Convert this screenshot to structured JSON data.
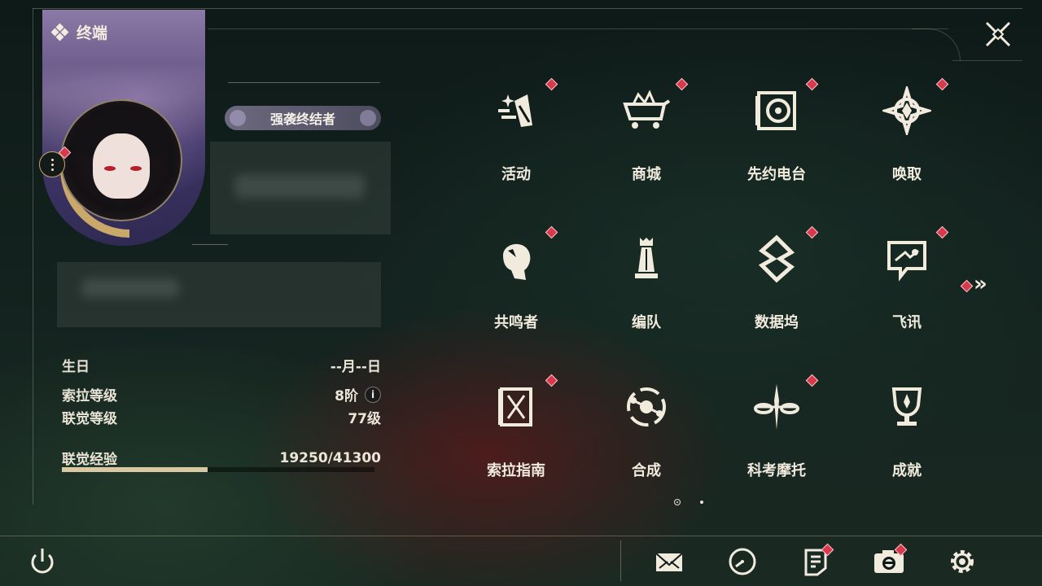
{
  "terminal": {
    "title": "终端"
  },
  "profile": {
    "title_badge": "强袭终结者"
  },
  "stats": {
    "birthday_label": "生日",
    "birthday_value": "--月--日",
    "sola_level_label": "索拉等级",
    "sola_level_value": "8阶",
    "union_level_label": "联觉等级",
    "union_level_value": "77级",
    "union_exp_label": "联觉经验",
    "union_exp_value": "19250/41300",
    "union_exp_progress": 0.466
  },
  "menu": {
    "items": [
      {
        "label": "活动",
        "icon": "activity-icon",
        "badge": true
      },
      {
        "label": "商城",
        "icon": "shop-crown-cart-icon",
        "badge": true
      },
      {
        "label": "先约电台",
        "icon": "radio-icon",
        "badge": true
      },
      {
        "label": "唤取",
        "icon": "convene-compass-icon",
        "badge": true
      },
      {
        "label": "共鸣者",
        "icon": "resonator-head-icon",
        "badge": true
      },
      {
        "label": "编队",
        "icon": "team-chess-icon",
        "badge": false
      },
      {
        "label": "数据坞",
        "icon": "data-bank-icon",
        "badge": true
      },
      {
        "label": "飞讯",
        "icon": "chat-message-icon",
        "badge": true
      },
      {
        "label": "索拉指南",
        "icon": "guidebook-icon",
        "badge": true
      },
      {
        "label": "合成",
        "icon": "synthesis-icon",
        "badge": false
      },
      {
        "label": "科考摩托",
        "icon": "motorbike-icon",
        "badge": true
      },
      {
        "label": "成就",
        "icon": "trophy-icon",
        "badge": false
      }
    ],
    "page_arrow": "»"
  },
  "info_icon": "i",
  "colors": {
    "badge": "#d9394a",
    "gold": "#c9a86a",
    "text": "#ece6d8"
  }
}
